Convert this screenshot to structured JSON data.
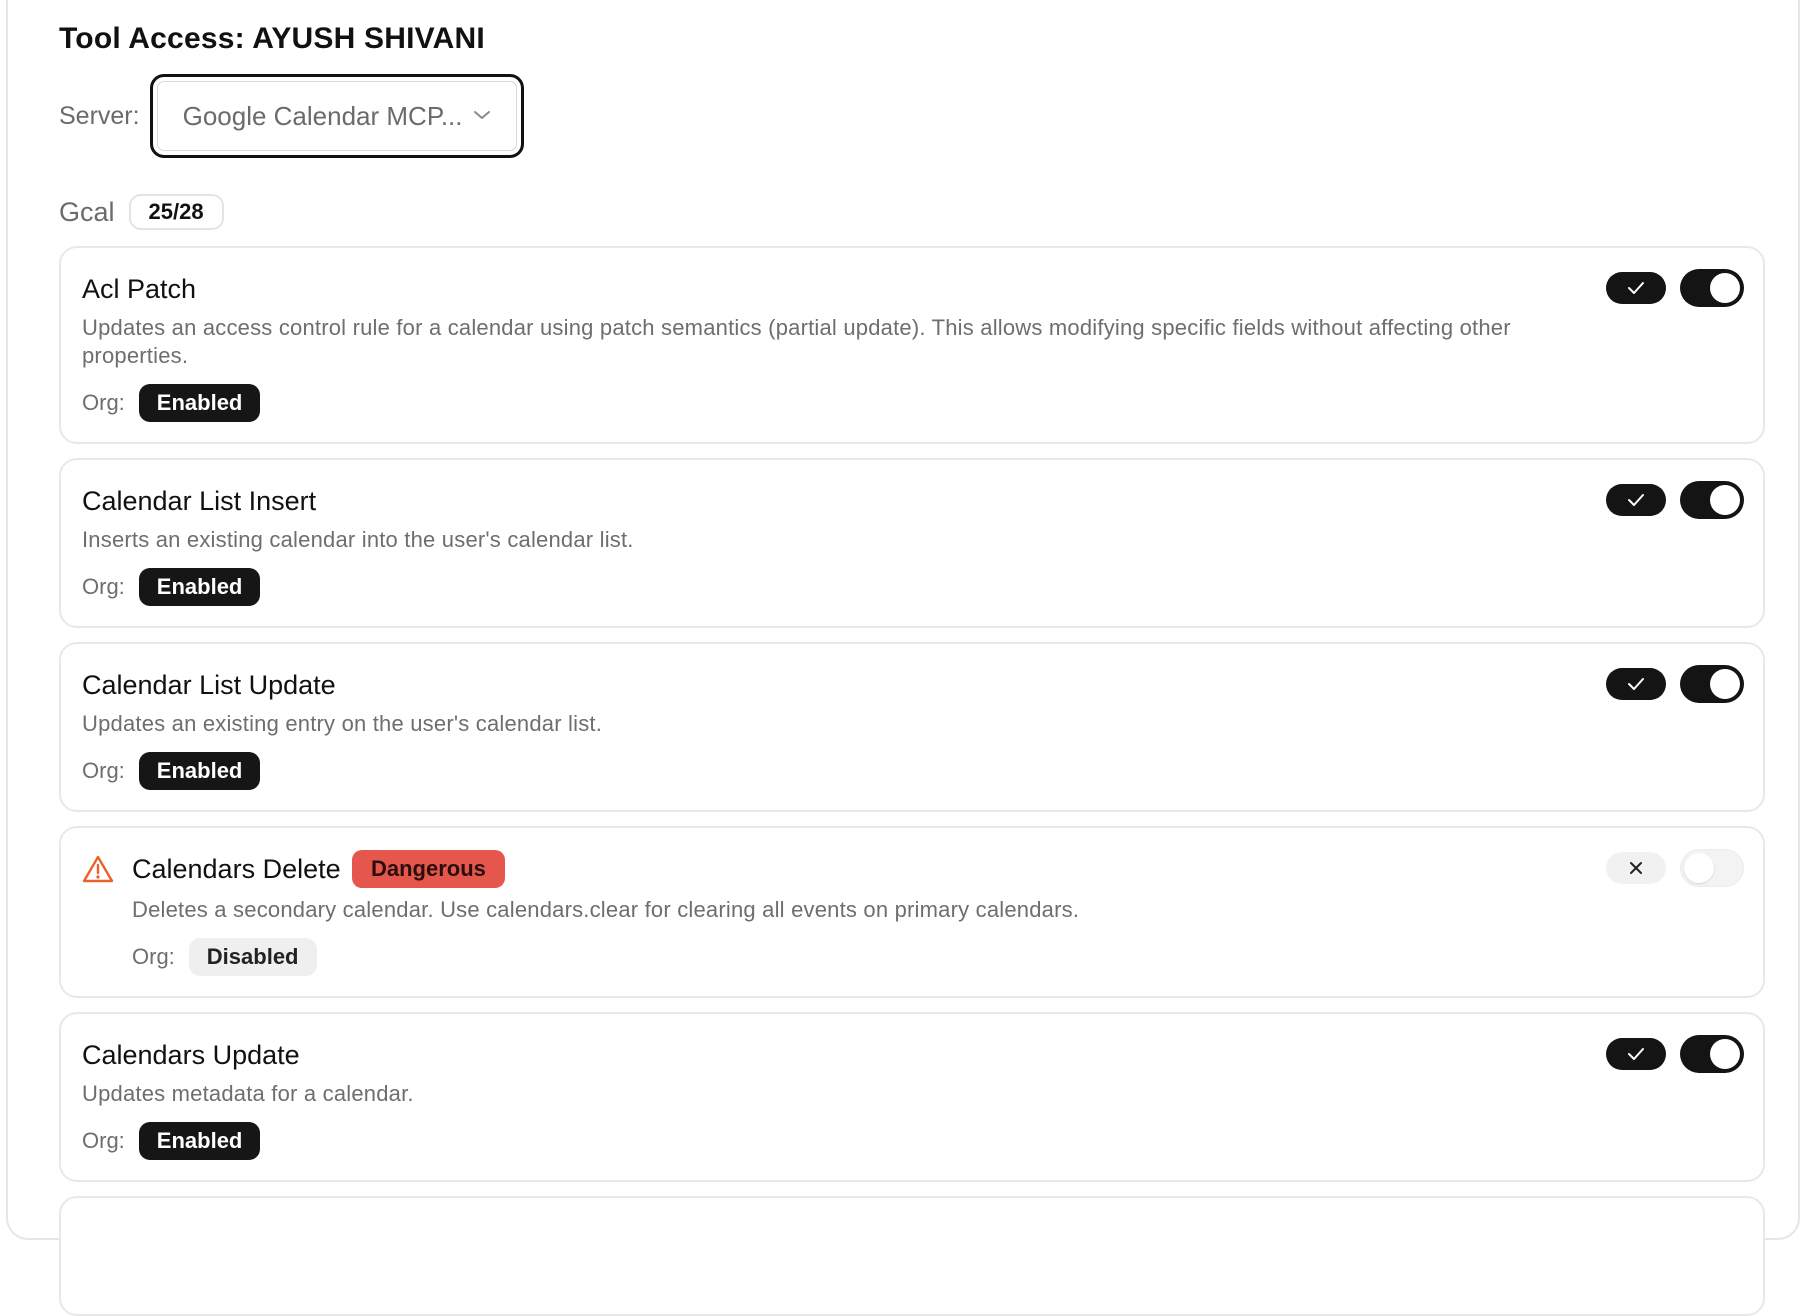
{
  "title": "Tool Access: AYUSH SHIVANI",
  "server": {
    "label": "Server:",
    "value": "Google Calendar MCP..."
  },
  "group": {
    "name": "Gcal",
    "count": "25/28"
  },
  "org_label": "Org:",
  "tools": [
    {
      "name": "Acl Patch",
      "description": "Updates an access control rule for a calendar using patch semantics (partial update). This allows modifying specific fields without affecting other properties.",
      "org_status": "Enabled",
      "enabled": true
    },
    {
      "name": "Calendar List Insert",
      "description": "Inserts an existing calendar into the user's calendar list.",
      "org_status": "Enabled",
      "enabled": true
    },
    {
      "name": "Calendar List Update",
      "description": "Updates an existing entry on the user's calendar list.",
      "org_status": "Enabled",
      "enabled": true
    },
    {
      "name": "Calendars Delete",
      "badge": "Dangerous",
      "description": "Deletes a secondary calendar. Use calendars.clear for clearing all events on primary calendars.",
      "org_status": "Disabled",
      "enabled": false,
      "icon": "warning-icon"
    },
    {
      "name": "Calendars Update",
      "description": "Updates metadata for a calendar.",
      "org_status": "Enabled",
      "enabled": true
    }
  ],
  "colors": {
    "accent": "#141414",
    "danger": "#e5574c",
    "warning": "#e8622c"
  }
}
